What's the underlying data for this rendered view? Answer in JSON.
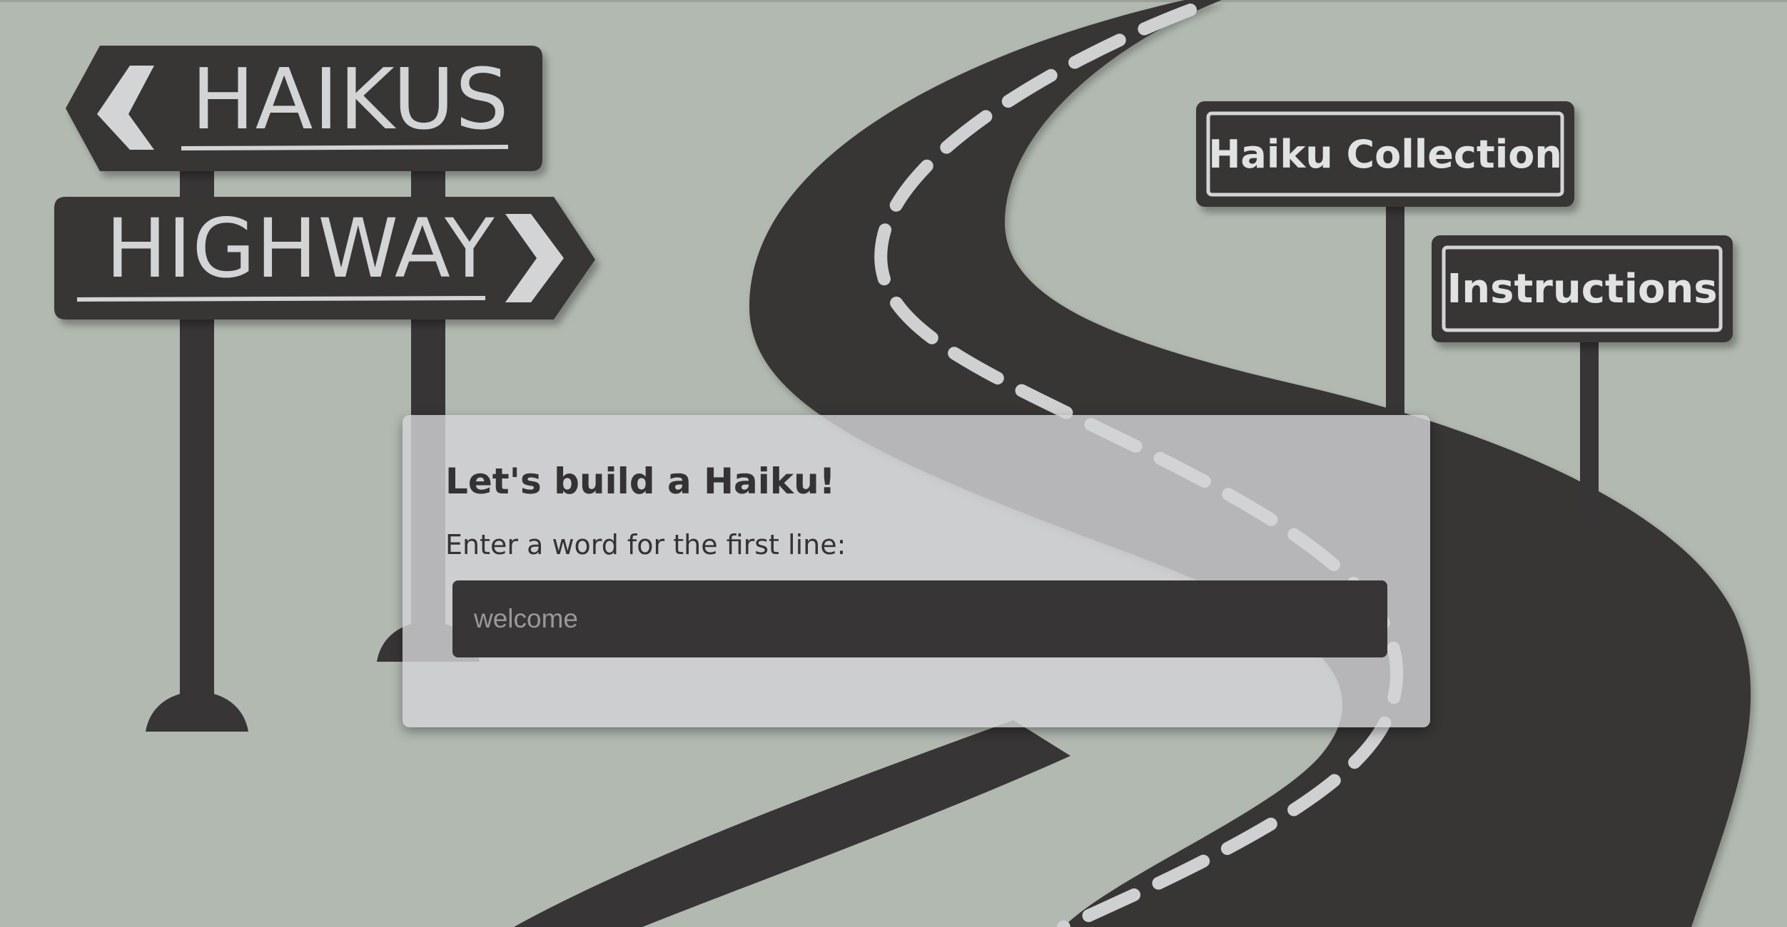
{
  "logo": {
    "top_word": "HAIKUS",
    "bottom_word": "HIGHWAY"
  },
  "nav": {
    "collection_label": "Haiku Collection",
    "instructions_label": "Instructions"
  },
  "builder": {
    "title": "Let's build a Haiku!",
    "prompt": "Enter a word for the first line:",
    "input_placeholder": "welcome",
    "input_value": ""
  },
  "colors": {
    "background": "#b1b9b0",
    "asphalt": "#383536",
    "sign_text": "#d3d4d5",
    "lane_marking": "#cfd0d2",
    "panel": "#d2d3d5"
  },
  "icons": {
    "left_arrow": "chevron-left-icon",
    "right_arrow": "chevron-right-icon"
  }
}
